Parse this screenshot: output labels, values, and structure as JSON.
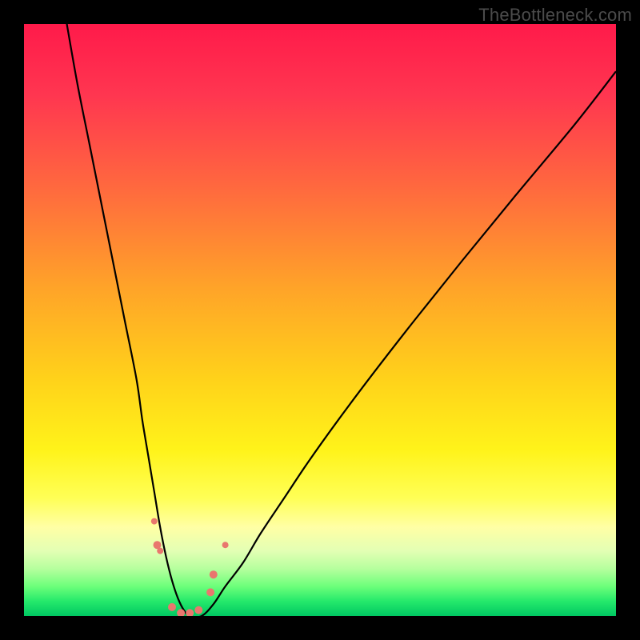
{
  "watermark": "TheBottleneck.com",
  "colors": {
    "bg_black": "#000000",
    "curve": "#000000",
    "marker_fill": "#e9776e",
    "marker_stroke": "#cc5a52",
    "gradient_stops": [
      {
        "offset": 0.0,
        "color": "#ff1a4a"
      },
      {
        "offset": 0.12,
        "color": "#ff3650"
      },
      {
        "offset": 0.28,
        "color": "#ff6a3e"
      },
      {
        "offset": 0.45,
        "color": "#ffa528"
      },
      {
        "offset": 0.6,
        "color": "#ffd21a"
      },
      {
        "offset": 0.72,
        "color": "#fff31a"
      },
      {
        "offset": 0.8,
        "color": "#ffff55"
      },
      {
        "offset": 0.85,
        "color": "#ffffa5"
      },
      {
        "offset": 0.89,
        "color": "#e3ffb4"
      },
      {
        "offset": 0.92,
        "color": "#b6ff9e"
      },
      {
        "offset": 0.95,
        "color": "#6cff7a"
      },
      {
        "offset": 0.975,
        "color": "#25e96b"
      },
      {
        "offset": 1.0,
        "color": "#00c862"
      }
    ]
  },
  "chart_data": {
    "type": "line",
    "title": "",
    "xlabel": "",
    "ylabel": "",
    "xlim": [
      0,
      100
    ],
    "ylim": [
      0,
      100
    ],
    "grid": false,
    "series": [
      {
        "name": "bottleneck-curve",
        "x": [
          7,
          9,
          11,
          13,
          15,
          17,
          19,
          20,
          21,
          22,
          23,
          24,
          25,
          26,
          27,
          28,
          30,
          32,
          34,
          37,
          40,
          44,
          48,
          53,
          59,
          66,
          74,
          83,
          93,
          100
        ],
        "values": [
          100,
          90,
          80,
          70,
          60,
          50,
          40,
          33,
          27,
          21,
          15,
          10,
          6,
          3,
          1,
          0,
          0,
          2,
          5,
          9,
          14,
          20,
          26,
          33,
          41,
          50,
          60,
          71,
          83,
          92
        ]
      }
    ],
    "markers": [
      {
        "x": 22.0,
        "y": 16.0,
        "r": 4
      },
      {
        "x": 22.5,
        "y": 12.0,
        "r": 5
      },
      {
        "x": 23.0,
        "y": 11.0,
        "r": 4
      },
      {
        "x": 25.0,
        "y": 1.5,
        "r": 5
      },
      {
        "x": 26.5,
        "y": 0.5,
        "r": 5
      },
      {
        "x": 28.0,
        "y": 0.5,
        "r": 5
      },
      {
        "x": 29.5,
        "y": 1.0,
        "r": 5
      },
      {
        "x": 31.5,
        "y": 4.0,
        "r": 5
      },
      {
        "x": 32.0,
        "y": 7.0,
        "r": 5
      },
      {
        "x": 34.0,
        "y": 12.0,
        "r": 4
      }
    ],
    "annotations": []
  }
}
